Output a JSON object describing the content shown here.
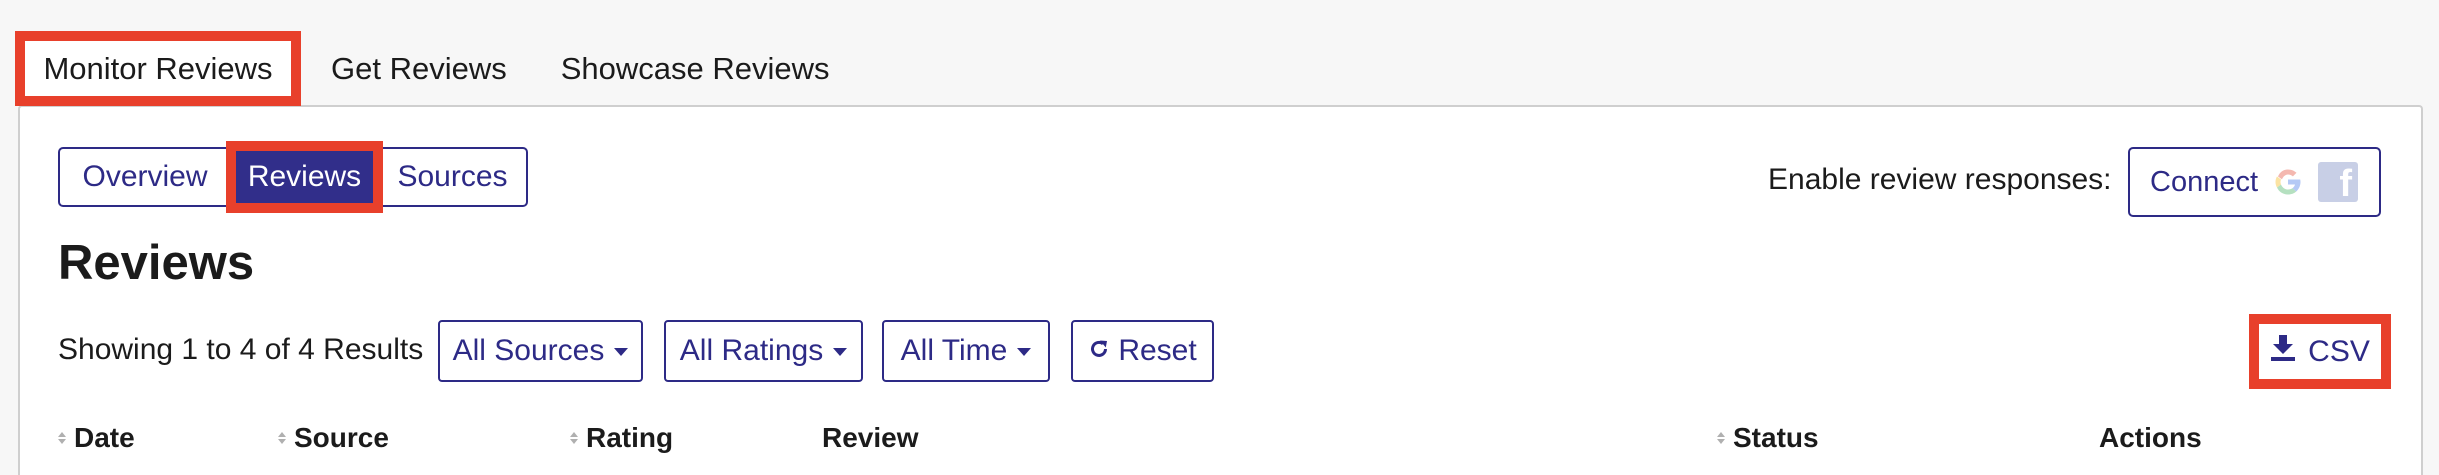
{
  "top_tabs": [
    {
      "label": "Monitor Reviews",
      "active": true
    },
    {
      "label": "Get Reviews",
      "active": false
    },
    {
      "label": "Showcase Reviews",
      "active": false
    }
  ],
  "sub_tabs": [
    {
      "label": "Overview",
      "active": false
    },
    {
      "label": "Reviews",
      "active": true
    },
    {
      "label": "Sources",
      "active": false
    }
  ],
  "review_responses": {
    "label": "Enable review responses:",
    "connect_label": "Connect",
    "icons": [
      "google-icon",
      "facebook-icon"
    ]
  },
  "page": {
    "title": "Reviews",
    "showing": "Showing 1 to 4 of 4 Results"
  },
  "filters": {
    "sources": "All Sources",
    "ratings": "All Ratings",
    "time": "All Time",
    "reset": "Reset"
  },
  "export": {
    "csv_label": "CSV"
  },
  "table": {
    "columns": [
      "Date",
      "Source",
      "Rating",
      "Review",
      "Status",
      "Actions"
    ]
  },
  "colors": {
    "accent": "#2d2a86",
    "highlight": "#e8402b",
    "active_bg": "#312e8a"
  }
}
